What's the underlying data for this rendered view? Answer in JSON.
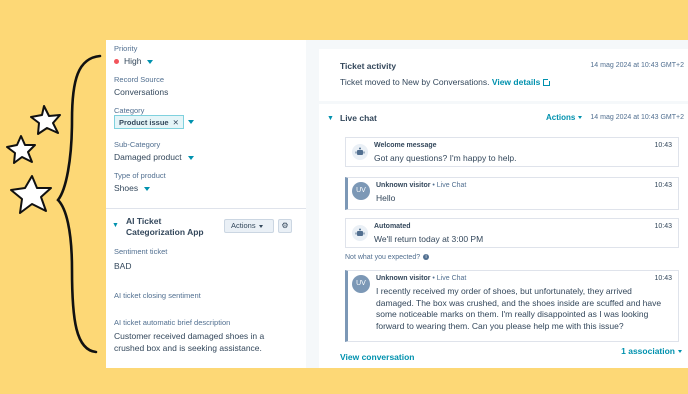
{
  "properties": {
    "priority_label": "Priority",
    "priority_value": "High",
    "record_source_label": "Record Source",
    "record_source_value": "Conversations",
    "category_label": "Category",
    "category_tag": "Product issue",
    "subcategory_label": "Sub-Category",
    "subcategory_value": "Damaged product",
    "product_type_label": "Type of product",
    "product_type_value": "Shoes"
  },
  "ai_section": {
    "title": "AI Ticket Categorization App",
    "actions_label": "Actions",
    "sentiment_label": "Sentiment ticket",
    "sentiment_value": "BAD",
    "closing_sentiment_label": "AI ticket closing sentiment",
    "brief_label": "AI ticket automatic brief description",
    "brief_value": "Customer received damaged shoes in a crushed box and is seeking assistance."
  },
  "activity": {
    "title": "Ticket activity",
    "timestamp": "14 mag 2024 at 10:43 GMT+2",
    "text": "Ticket moved to New by Conversations.",
    "link": "View details"
  },
  "chat": {
    "title": "Live chat",
    "actions_label": "Actions",
    "timestamp": "14 mag 2024 at 10:43 GMT+2",
    "feedback_text": "Not what you expected?",
    "view_conversation": "View conversation",
    "associations": "1 association",
    "messages": [
      {
        "sender": "Welcome message",
        "sub": "",
        "time": "10:43",
        "text": "Got any questions? I'm happy to help.",
        "avatar": ""
      },
      {
        "sender": "Unknown visitor",
        "sub": "• Live Chat",
        "time": "10:43",
        "text": "Hello",
        "avatar": "UV"
      },
      {
        "sender": "Automated",
        "sub": "",
        "time": "10:43",
        "text": "We'll return today at 3:00 PM",
        "avatar": ""
      },
      {
        "sender": "Unknown visitor",
        "sub": "• Live Chat",
        "time": "10:43",
        "text": "I recently received my order of shoes, but unfortunately, they arrived damaged. The box was crushed, and the shoes inside are scuffed and have some noticeable marks on them. I'm really disappointed as I was looking forward to wearing them. Can you please help me with this issue?",
        "avatar": "UV"
      }
    ]
  },
  "colors": {
    "background": "#fdd876",
    "accent": "#0091ae",
    "priority_high": "#f2545b"
  }
}
